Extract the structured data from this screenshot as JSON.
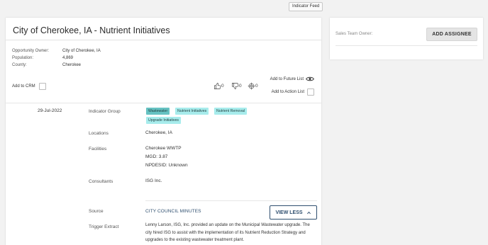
{
  "top": {
    "indicator_feed": "Indicator Feed"
  },
  "header": {
    "title": "City of Cherokee, IA - Nutrient Initiatives"
  },
  "details": [
    {
      "key": "Opportunity Owner:",
      "value": "City of Cherokee, IA"
    },
    {
      "key": "Population:",
      "value": "4,869"
    },
    {
      "key": "County:",
      "value": "Cherokee"
    }
  ],
  "actions": {
    "add_to_crm": "Add to CRM",
    "thumbs_up_count": "0",
    "thumbs_down_count": "0",
    "target_count": "0",
    "add_to_future_list": "Add to Future List",
    "add_to_action_list": "Add to Action List"
  },
  "record": {
    "date": "29-Jul-2022",
    "indicator_group_label": "Indicator Group",
    "tags": [
      "Wastewater",
      "Nutrient Initiatives",
      "Nutrient Removal",
      "Upgrade Initiatives"
    ],
    "locations_label": "Locations",
    "locations_value": "Cherokee, IA",
    "facilities_label": "Facilities",
    "facility_name": "Cherokee WWTP",
    "facility_mgd": "MGD: 3.87",
    "facility_npdesid": "NPDESID: Unknown",
    "consultants_label": "Consultants",
    "consultants_value": "ISG Inc.",
    "source_label": "Source",
    "source_value": "CITY COUNCIL MINUTES",
    "view_less": "VIEW LESS",
    "trigger_label": "Trigger Extract",
    "trigger_text": "Lenny Larson, ISG, Inc. provided an update on the Municipal Wastewater upgrade. The city hired ISG to assist with the implementation of its Nutrient Reduction Strategy and upgrades to the existing wastewater treatment plant."
  },
  "side": {
    "sales_team_owner_label": "Sales Team Owner:",
    "add_assignee": "ADD ASSIGNEE"
  },
  "colors": {
    "tag": "#a7ecec",
    "tag_selected": "#66c2c2",
    "link": "#2f4f6f"
  }
}
